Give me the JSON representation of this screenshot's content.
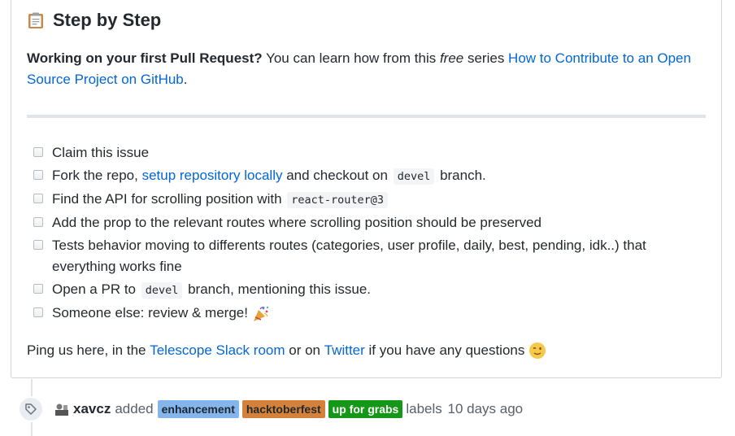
{
  "heading": {
    "title": "Step by Step",
    "icon": "clipboard-icon"
  },
  "intro": {
    "bold": "Working on your first Pull Request?",
    "text1": " You can learn how from this ",
    "em": "free",
    "text2": " series ",
    "link": "How to Contribute to an Open Source Project on GitHub",
    "end": "."
  },
  "tasks": [
    {
      "parts": [
        {
          "t": "Claim this issue"
        }
      ]
    },
    {
      "parts": [
        {
          "t": "Fork the repo, "
        },
        {
          "link": "setup repository locally"
        },
        {
          "t": " and checkout on "
        },
        {
          "code": "devel"
        },
        {
          "t": " branch."
        }
      ]
    },
    {
      "parts": [
        {
          "t": "Find the API for scrolling position with "
        },
        {
          "code": "react-router@3"
        }
      ]
    },
    {
      "parts": [
        {
          "t": "Add the prop to the relevant routes where scrolling position should be preserved"
        }
      ]
    },
    {
      "parts": [
        {
          "t": "Tests behavior moving to differents routes (categories, user profile, daily, best, pending, idk..) that everything works fine"
        }
      ]
    },
    {
      "parts": [
        {
          "t": "Open a PR to "
        },
        {
          "code": "devel"
        },
        {
          "t": " branch, mentioning this issue."
        }
      ]
    },
    {
      "parts": [
        {
          "t": "Someone else: review & merge! "
        }
      ],
      "emoji": "party-popper-icon"
    }
  ],
  "ping": {
    "text1": "Ping us here, in the ",
    "link1": "Telescope Slack room",
    "text2": " or on ",
    "link2": "Twitter",
    "text3": " if you have any questions ",
    "emoji": "winking-face-icon"
  },
  "event": {
    "icon": "tag-icon",
    "author": "xavcz",
    "action": "added",
    "labels": [
      {
        "name": "enhancement",
        "bg": "#84b6eb",
        "fg": "#1c2733"
      },
      {
        "name": "hacktoberfest",
        "bg": "#d4813b",
        "fg": "#24292e"
      },
      {
        "name": "up for grabs",
        "bg": "#159818",
        "fg": "#ffffff"
      }
    ],
    "suffix": "labels",
    "time": "10 days ago"
  }
}
